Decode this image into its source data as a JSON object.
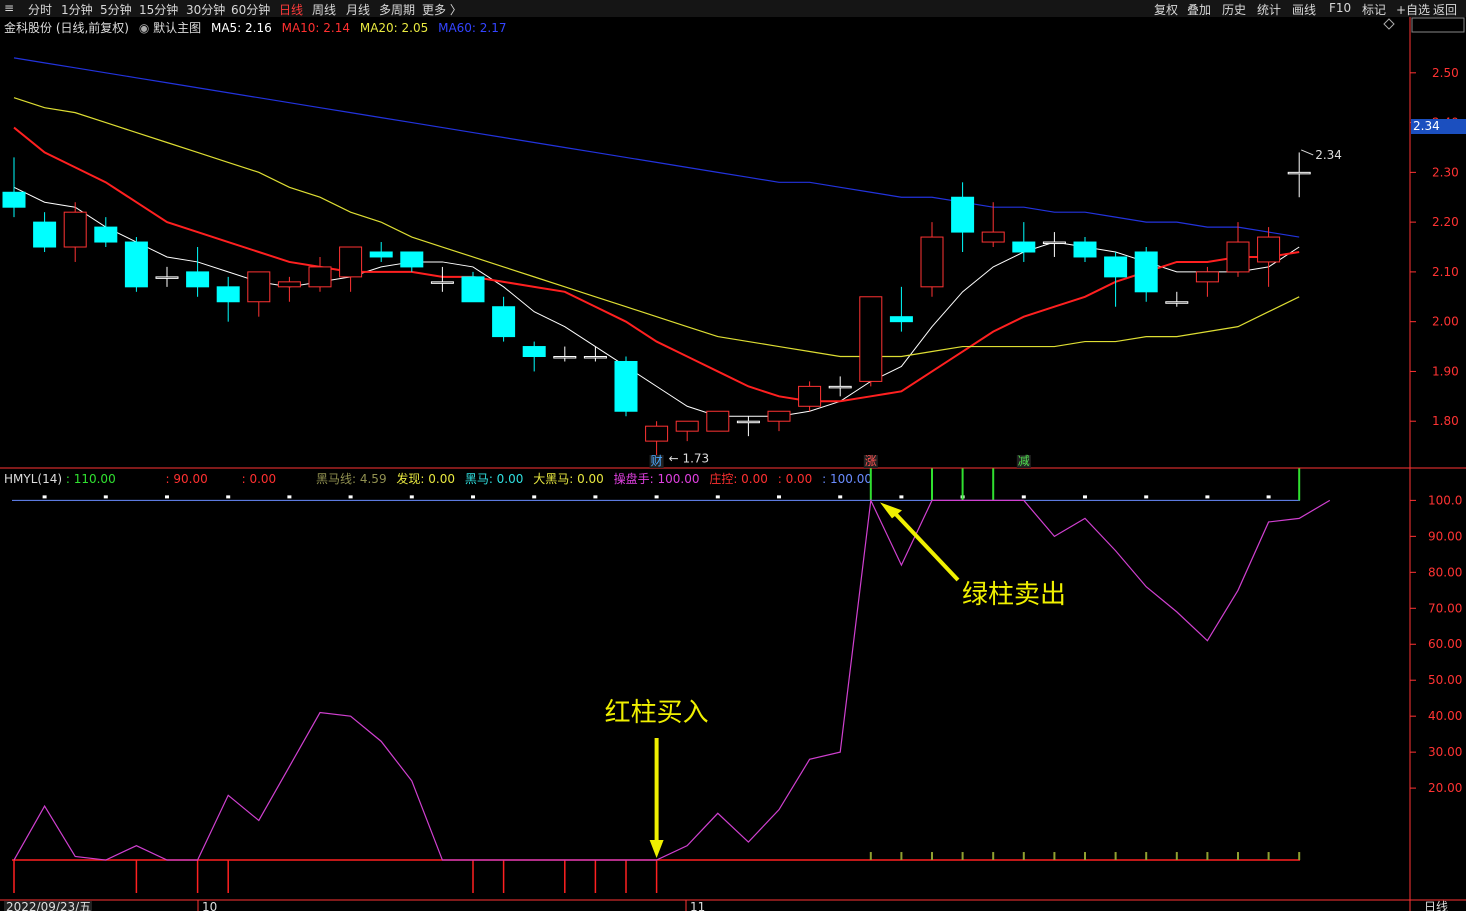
{
  "toolbar": {
    "left": [
      "分时",
      "1分钟",
      "5分钟",
      "15分钟",
      "30分钟",
      "60分钟",
      "日线",
      "周线",
      "月线",
      "多周期",
      "更多 〉"
    ],
    "active": "日线",
    "right": [
      "复权",
      "叠加",
      "历史",
      "统计",
      "画线",
      "F10",
      "标记",
      "+自选",
      "返回"
    ]
  },
  "main_header": {
    "stock": "金科股份 (日线,前复权)",
    "template": "默认主图",
    "ma5": "MA5: 2.16",
    "ma10": "MA10: 2.14",
    "ma20": "MA20: 2.05",
    "ma60": "MA60: 2.17"
  },
  "indicator_header": {
    "name": "HMYL(14)",
    "v1": ": 110.00",
    "v2": ": 90.00",
    "v3": ": 0.00",
    "heima_line": "黑马线: 4.59",
    "faxian": "发现: 0.00",
    "heima": "黑马: 0.00",
    "daheima": "大黑马: 0.00",
    "caopanshou": "操盘手: 100.00",
    "zhuangkong": "庄控: 0.00",
    "v4": ": 0.00",
    "v5": ": 100.00"
  },
  "colors": {
    "up": "#ff3333",
    "down": "#00ffff",
    "ma5": "#ffffff",
    "ma10": "#ff2020",
    "ma20": "#dddd33",
    "ma60": "#2233dd",
    "purple": "#d040d0",
    "axis": "#ff3333"
  },
  "chart_data": {
    "type": "candlestick",
    "price_axis": {
      "ticks": [
        "2.50",
        "2.40",
        "2.30",
        "2.20",
        "2.10",
        "2.00",
        "1.90",
        "1.80"
      ],
      "range": [
        1.71,
        2.58
      ]
    },
    "indicator_axis": {
      "ticks": [
        "100.0",
        "90.00",
        "80.00",
        "70.00",
        "60.00",
        "50.00",
        "40.00",
        "30.00",
        "20.00"
      ],
      "range": [
        -10,
        104
      ]
    },
    "annotations": {
      "high": "2.34",
      "low": "1.73",
      "current_price": "2.34"
    },
    "markers": [
      "财",
      "涨",
      "减"
    ],
    "x_labels": [
      "2022/09/23/五",
      "10",
      "11"
    ],
    "bottom_right_label": "日线",
    "candles": [
      {
        "o": 2.26,
        "h": 2.33,
        "l": 2.21,
        "c": 2.23
      },
      {
        "o": 2.2,
        "h": 2.22,
        "l": 2.14,
        "c": 2.15
      },
      {
        "o": 2.15,
        "h": 2.24,
        "l": 2.12,
        "c": 2.22
      },
      {
        "o": 2.19,
        "h": 2.21,
        "l": 2.15,
        "c": 2.16
      },
      {
        "o": 2.16,
        "h": 2.17,
        "l": 2.06,
        "c": 2.07
      },
      {
        "o": 2.09,
        "h": 2.11,
        "l": 2.07,
        "c": 2.09
      },
      {
        "o": 2.1,
        "h": 2.15,
        "l": 2.05,
        "c": 2.07
      },
      {
        "o": 2.07,
        "h": 2.09,
        "l": 2.0,
        "c": 2.04
      },
      {
        "o": 2.04,
        "h": 2.1,
        "l": 2.01,
        "c": 2.1
      },
      {
        "o": 2.07,
        "h": 2.09,
        "l": 2.04,
        "c": 2.08
      },
      {
        "o": 2.07,
        "h": 2.13,
        "l": 2.06,
        "c": 2.11
      },
      {
        "o": 2.09,
        "h": 2.15,
        "l": 2.06,
        "c": 2.15
      },
      {
        "o": 2.14,
        "h": 2.16,
        "l": 2.12,
        "c": 2.13
      },
      {
        "o": 2.14,
        "h": 2.14,
        "l": 2.1,
        "c": 2.11
      },
      {
        "o": 2.08,
        "h": 2.11,
        "l": 2.06,
        "c": 2.08
      },
      {
        "o": 2.09,
        "h": 2.1,
        "l": 2.04,
        "c": 2.04
      },
      {
        "o": 2.03,
        "h": 2.05,
        "l": 1.96,
        "c": 1.97
      },
      {
        "o": 1.95,
        "h": 1.96,
        "l": 1.9,
        "c": 1.93
      },
      {
        "o": 1.93,
        "h": 1.95,
        "l": 1.92,
        "c": 1.93
      },
      {
        "o": 1.93,
        "h": 1.95,
        "l": 1.92,
        "c": 1.93
      },
      {
        "o": 1.92,
        "h": 1.93,
        "l": 1.81,
        "c": 1.82
      },
      {
        "o": 1.76,
        "h": 1.8,
        "l": 1.73,
        "c": 1.79
      },
      {
        "o": 1.78,
        "h": 1.8,
        "l": 1.76,
        "c": 1.8
      },
      {
        "o": 1.78,
        "h": 1.82,
        "l": 1.78,
        "c": 1.82
      },
      {
        "o": 1.8,
        "h": 1.81,
        "l": 1.77,
        "c": 1.8
      },
      {
        "o": 1.8,
        "h": 1.82,
        "l": 1.78,
        "c": 1.82
      },
      {
        "o": 1.83,
        "h": 1.88,
        "l": 1.82,
        "c": 1.87
      },
      {
        "o": 1.87,
        "h": 1.89,
        "l": 1.85,
        "c": 1.87
      },
      {
        "o": 1.88,
        "h": 2.05,
        "l": 1.87,
        "c": 2.05
      },
      {
        "o": 2.01,
        "h": 2.07,
        "l": 1.98,
        "c": 2.0
      },
      {
        "o": 2.07,
        "h": 2.2,
        "l": 2.05,
        "c": 2.17
      },
      {
        "o": 2.25,
        "h": 2.28,
        "l": 2.14,
        "c": 2.18
      },
      {
        "o": 2.16,
        "h": 2.24,
        "l": 2.15,
        "c": 2.18
      },
      {
        "o": 2.16,
        "h": 2.2,
        "l": 2.12,
        "c": 2.14
      },
      {
        "o": 2.16,
        "h": 2.18,
        "l": 2.13,
        "c": 2.16
      },
      {
        "o": 2.16,
        "h": 2.17,
        "l": 2.12,
        "c": 2.13
      },
      {
        "o": 2.13,
        "h": 2.14,
        "l": 2.03,
        "c": 2.09
      },
      {
        "o": 2.14,
        "h": 2.15,
        "l": 2.04,
        "c": 2.06
      },
      {
        "o": 2.04,
        "h": 2.06,
        "l": 2.03,
        "c": 2.04
      },
      {
        "o": 2.08,
        "h": 2.11,
        "l": 2.05,
        "c": 2.1
      },
      {
        "o": 2.1,
        "h": 2.2,
        "l": 2.09,
        "c": 2.16
      },
      {
        "o": 2.12,
        "h": 2.19,
        "l": 2.07,
        "c": 2.17
      },
      {
        "o": 2.3,
        "h": 2.34,
        "l": 2.25,
        "c": 2.3
      }
    ],
    "series": [
      {
        "name": "MA5",
        "values": [
          2.27,
          2.24,
          2.23,
          2.19,
          2.16,
          2.13,
          2.12,
          2.1,
          2.08,
          2.07,
          2.08,
          2.09,
          2.11,
          2.12,
          2.12,
          2.11,
          2.07,
          2.02,
          1.99,
          1.95,
          1.91,
          1.87,
          1.83,
          1.81,
          1.81,
          1.81,
          1.82,
          1.84,
          1.88,
          1.91,
          1.99,
          2.06,
          2.11,
          2.14,
          2.16,
          2.15,
          2.14,
          2.12,
          2.1,
          2.1,
          2.1,
          2.11,
          2.15
        ]
      },
      {
        "name": "MA10",
        "values": [
          2.39,
          2.34,
          2.31,
          2.28,
          2.24,
          2.2,
          2.18,
          2.16,
          2.14,
          2.12,
          2.11,
          2.1,
          2.1,
          2.1,
          2.09,
          2.09,
          2.08,
          2.07,
          2.06,
          2.03,
          2.0,
          1.96,
          1.93,
          1.9,
          1.87,
          1.85,
          1.84,
          1.84,
          1.85,
          1.86,
          1.9,
          1.94,
          1.98,
          2.01,
          2.03,
          2.05,
          2.08,
          2.1,
          2.12,
          2.12,
          2.13,
          2.13,
          2.14
        ]
      },
      {
        "name": "MA20",
        "values": [
          2.45,
          2.43,
          2.42,
          2.4,
          2.38,
          2.36,
          2.34,
          2.32,
          2.3,
          2.27,
          2.25,
          2.22,
          2.2,
          2.17,
          2.15,
          2.13,
          2.11,
          2.09,
          2.07,
          2.05,
          2.03,
          2.01,
          1.99,
          1.97,
          1.96,
          1.95,
          1.94,
          1.93,
          1.93,
          1.93,
          1.94,
          1.95,
          1.95,
          1.95,
          1.95,
          1.96,
          1.96,
          1.97,
          1.97,
          1.98,
          1.99,
          2.02,
          2.05
        ]
      },
      {
        "name": "MA60",
        "values": [
          2.53,
          2.52,
          2.51,
          2.5,
          2.49,
          2.48,
          2.47,
          2.46,
          2.45,
          2.44,
          2.43,
          2.42,
          2.41,
          2.4,
          2.39,
          2.38,
          2.37,
          2.36,
          2.35,
          2.34,
          2.33,
          2.32,
          2.31,
          2.3,
          2.29,
          2.28,
          2.28,
          2.27,
          2.26,
          2.25,
          2.25,
          2.24,
          2.23,
          2.23,
          2.22,
          2.22,
          2.21,
          2.2,
          2.2,
          2.19,
          2.19,
          2.18,
          2.17
        ]
      },
      {
        "name": "操盘手",
        "values": [
          0,
          15,
          1,
          0,
          4,
          0,
          0,
          18,
          11,
          26,
          41,
          40,
          33,
          22,
          0,
          0,
          0,
          0,
          0,
          0,
          0,
          0,
          4,
          13,
          5,
          14,
          28,
          30,
          100,
          82,
          100,
          100,
          100,
          100,
          90,
          95,
          86,
          76,
          69,
          61,
          75,
          94,
          95,
          100
        ]
      }
    ],
    "indicator_bars": {
      "red": [
        1,
        0,
        0,
        0,
        1,
        0,
        1,
        1,
        0,
        0,
        0,
        0,
        0,
        0,
        0,
        1,
        1,
        0,
        1,
        1,
        1,
        1,
        0,
        0,
        0,
        0,
        0,
        0,
        0,
        0,
        0,
        0,
        0,
        0,
        0,
        0,
        0,
        0,
        0,
        0,
        0,
        0,
        0
      ],
      "green": [
        0,
        0,
        0,
        0,
        0,
        0,
        0,
        0,
        0,
        0,
        0,
        0,
        0,
        0,
        0,
        0,
        0,
        0,
        0,
        0,
        0,
        0,
        0,
        0,
        0,
        0,
        0,
        0,
        1,
        0,
        1,
        1,
        1,
        0,
        0,
        0,
        0,
        0,
        0,
        0,
        0,
        0,
        1
      ]
    },
    "callouts": {
      "sell": "绿柱卖出",
      "buy": "红柱买入"
    }
  }
}
